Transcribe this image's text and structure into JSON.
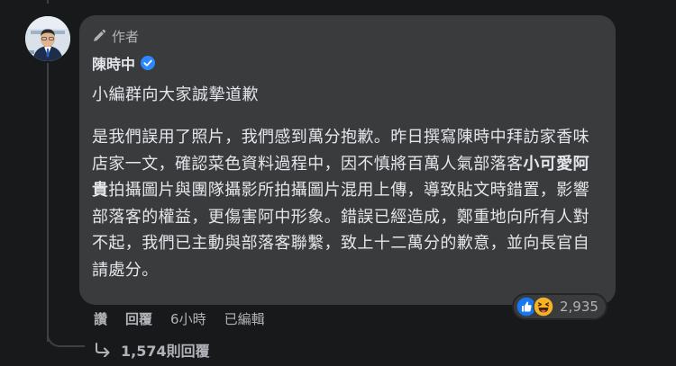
{
  "comment": {
    "author_badge": "作者",
    "author_name": "陳時中",
    "title_line": "小編群向大家誠摯道歉",
    "body_parts": [
      "是我們誤用了照片，我們感到萬分抱歉。昨日撰寫陳時中拜訪家香味店家一文，確認菜色資料過程中，因不慎將百萬人氣部落客",
      "小可愛阿貴",
      "拍攝圖片與團隊攝影所拍攝圖片混用上傳，導致貼文時錯置，影響部落客的權益，更傷害阿中形象。錯誤已經造成，鄭重地向所有人對不起，我們已主動與部落客聯繫，致上十二萬分的歉意，並向長官自請處分。"
    ]
  },
  "actions": {
    "like_label": "讚",
    "reply_label": "回覆",
    "time": "6小時",
    "edited": "已編輯"
  },
  "reactions": {
    "types": [
      "like-icon",
      "haha-icon"
    ],
    "count": "2,935"
  },
  "replies": {
    "label": "1,574則回覆"
  },
  "colors": {
    "background": "#18191a",
    "bubble": "#3a3b3c",
    "text": "#e4e6eb",
    "secondary_text": "#b0b3b8",
    "verified_blue": "#2d88ff",
    "like_blue": "#1877f2",
    "haha_yellow": "#f7b125"
  }
}
